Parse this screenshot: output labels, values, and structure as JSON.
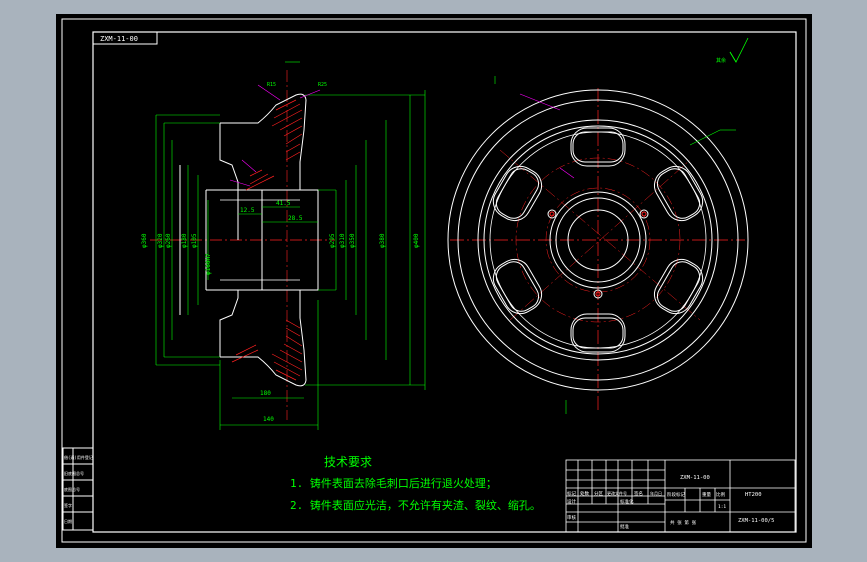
{
  "drawing": {
    "top_left_code": "ZXM-11-00",
    "surface_symbol_text": "其余",
    "tech_title": "技术要求",
    "tech_lines": [
      "1. 铸件表面去除毛刺口后进行退火处理；",
      "2. 铸件表面应光洁，不允许有夹渣、裂纹、缩孔。"
    ],
    "dims_left": {
      "d1": "φ360",
      "d2": "φ320",
      "d3": "φ260",
      "d4": "φ180",
      "d5": "φ160H7",
      "d6": "φ105",
      "d7": "φ295",
      "d8": "φ310",
      "d9": "φ350",
      "d10": "φ380",
      "d11": "φ400"
    },
    "dims_right": {
      "r1": "R15",
      "r2": "R25"
    },
    "dims_horizontal": {
      "w1": "140",
      "w2": "41.5",
      "w3": "28.5",
      "w4": "12.5",
      "w5": "180"
    },
    "title_block": {
      "part_name": "ZXM-11-00",
      "material": "HT200",
      "drawing_no": "ZXM-11-00/5",
      "scale_label": "比例",
      "labels_row": [
        "标记",
        "处数",
        "分区",
        "更改文件号",
        "签名",
        "年月日"
      ],
      "label_design": "设计",
      "label_check": "审核",
      "label_std": "标准化",
      "label_approve": "批准",
      "label_stage": "阶段标记",
      "label_weight": "重量",
      "label_scale": "比例",
      "label_sheet": "共 张 第 张",
      "scale_value": "1:1"
    },
    "side_block": [
      "借(通)用件登记",
      "旧底图总号",
      "底图总号",
      "签字",
      "日期"
    ]
  },
  "colors": {
    "background": "#000000",
    "outline": "#ffffff",
    "geometry": "#ffffff",
    "center": "#ff2020",
    "dimension": "#00ff00",
    "hatch": "#ff2020",
    "leader": "#ff00ff",
    "text": "#00ff00"
  }
}
